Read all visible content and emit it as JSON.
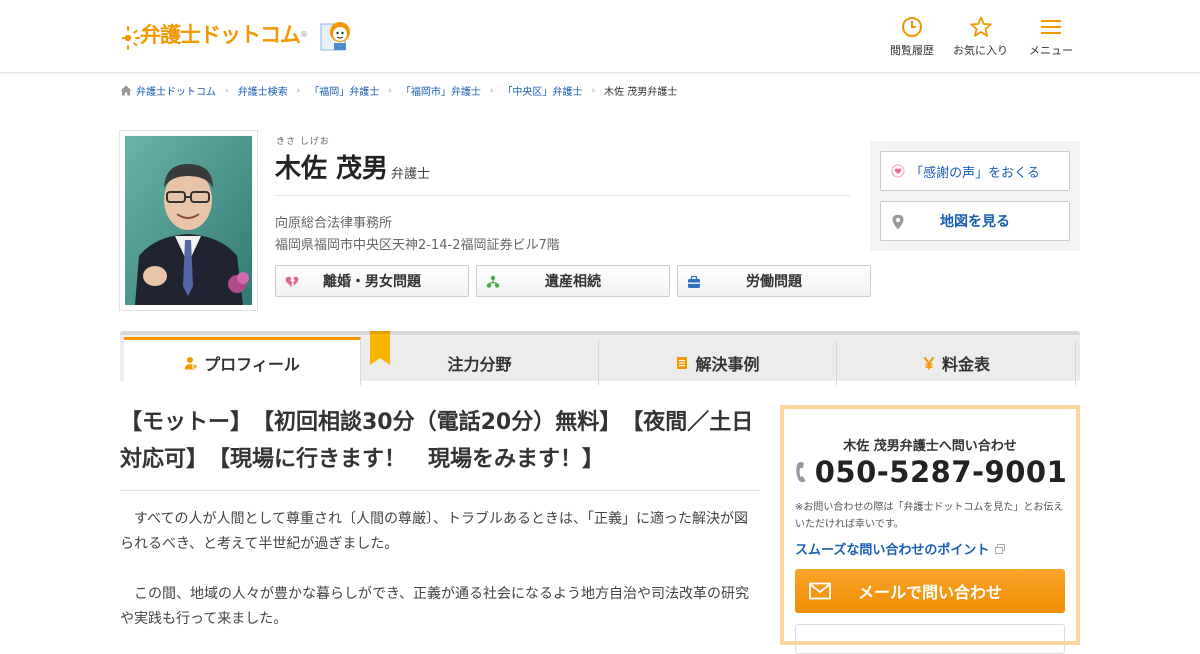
{
  "header": {
    "logo_text": "弁護士ドットコム",
    "logo_mark": "®",
    "nav": [
      {
        "label": "閲覧履歴",
        "icon": "clock-icon"
      },
      {
        "label": "お気に入り",
        "icon": "star-icon"
      },
      {
        "label": "メニュー",
        "icon": "menu-icon"
      }
    ],
    "accent_color": "#f39800"
  },
  "breadcrumb": {
    "items": [
      "弁護士ドットコム",
      "弁護士検索",
      "「福岡」弁護士",
      "「福岡市」弁護士",
      "「中央区」弁護士",
      "木佐 茂男弁護士"
    ]
  },
  "profile": {
    "ruby": "きさ しげお",
    "name": "木佐 茂男",
    "title": "弁護士",
    "office": "向原総合法律事務所",
    "address": "福岡県福岡市中央区天神2-14-2福岡証券ビル7階",
    "fields": [
      {
        "label": "離婚・男女問題",
        "icon": "broken-heart-icon"
      },
      {
        "label": "遺産相続",
        "icon": "family-tree-icon"
      },
      {
        "label": "労働問題",
        "icon": "briefcase-icon"
      }
    ]
  },
  "side": {
    "thanks_label": "「感謝の声」をおくる",
    "map_label": "地図を見る"
  },
  "tabs": [
    {
      "label": "プロフィール",
      "icon": "person-icon",
      "active": true
    },
    {
      "label": "注力分野",
      "icon": "",
      "active": false
    },
    {
      "label": "解決事例",
      "icon": "document-icon",
      "active": false
    },
    {
      "label": "料金表",
      "icon": "yen-icon",
      "active": false
    }
  ],
  "main": {
    "motto": "【モットー】　【初回相談30分（電話20分）無料】　【夜間／土日対応可】　【現場に行きます！　現場をみます！】",
    "paragraphs": [
      "すべての人が人間として尊重され〔人間の尊厳〕、トラブルあるときは、「正義」に適った解決が図られるべき、と考えて半世紀が過ぎました。",
      "この間、地域の人々が豊かな暮らしができ、正義が通る社会になるよう地方自治や司法改革の研究や実践も行って来ました。"
    ]
  },
  "contact": {
    "title": "木佐 茂男弁護士へ問い合わせ",
    "phone": "050-5287-9001",
    "note": "※お問い合わせの際は「弁護士ドットコムを見た」とお伝えいただければ幸いです。",
    "point_link": "スムーズな問い合わせのポイント",
    "mail_label": "メールで問い合わせ"
  }
}
